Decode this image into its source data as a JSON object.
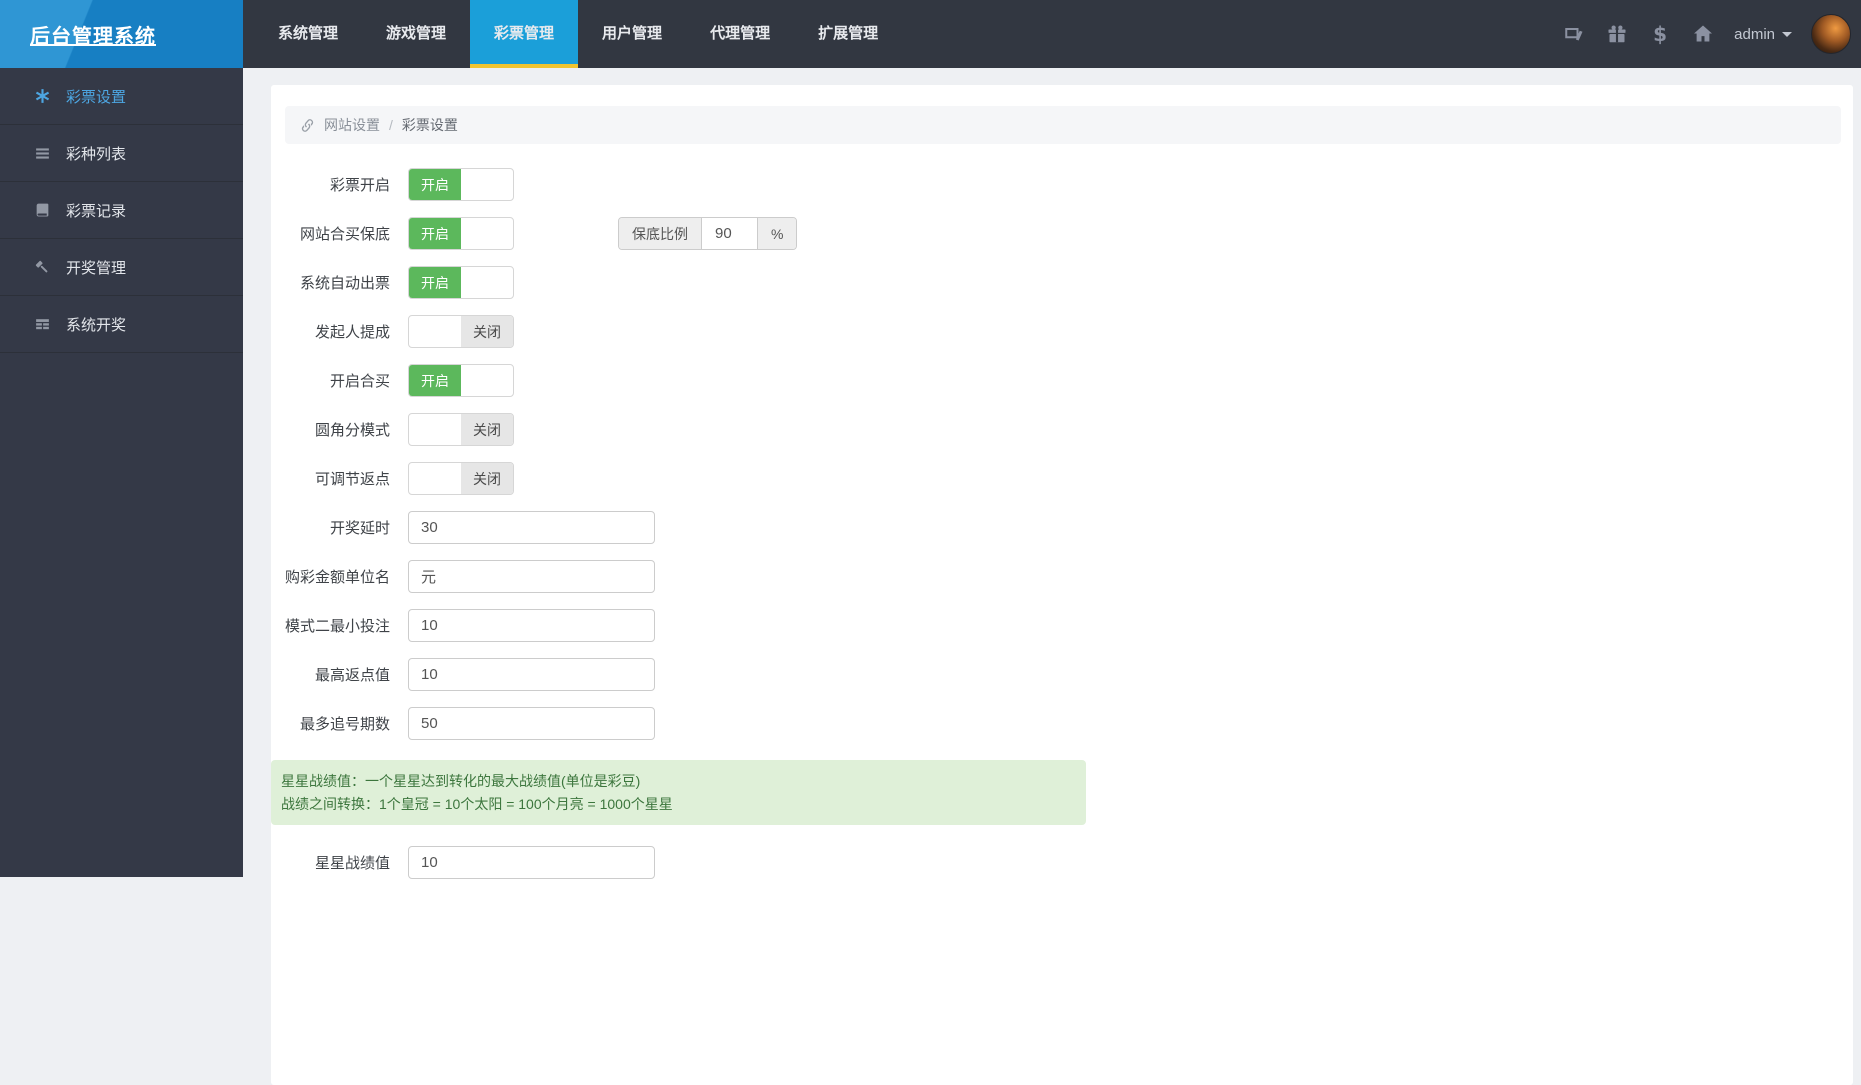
{
  "app": {
    "title": "后台管理系统"
  },
  "topnav": {
    "items": [
      {
        "label": "系统管理",
        "active": false
      },
      {
        "label": "游戏管理",
        "active": false
      },
      {
        "label": "彩票管理",
        "active": true
      },
      {
        "label": "用户管理",
        "active": false
      },
      {
        "label": "代理管理",
        "active": false
      },
      {
        "label": "扩展管理",
        "active": false
      }
    ],
    "icons": [
      "monitor-icon",
      "gift-icon",
      "dollar-icon",
      "home-icon"
    ],
    "user": "admin"
  },
  "sidebar": {
    "items": [
      {
        "label": "彩票设置",
        "icon": "asterisk-icon",
        "active": true
      },
      {
        "label": "彩种列表",
        "icon": "list-icon",
        "active": false
      },
      {
        "label": "彩票记录",
        "icon": "book-icon",
        "active": false
      },
      {
        "label": "开奖管理",
        "icon": "gavel-icon",
        "active": false
      },
      {
        "label": "系统开奖",
        "icon": "table-icon",
        "active": false
      }
    ]
  },
  "breadcrumb": {
    "parent": "网站设置",
    "separator": "/",
    "current": "彩票设置"
  },
  "form": {
    "toggle_on_label": "开启",
    "toggle_off_label": "关闭",
    "rows": [
      {
        "label": "彩票开启",
        "type": "toggle",
        "on": true
      },
      {
        "label": "网站合买保底",
        "type": "toggle",
        "on": true,
        "guarantee": true
      },
      {
        "label": "系统自动出票",
        "type": "toggle",
        "on": true
      },
      {
        "label": "发起人提成",
        "type": "toggle",
        "on": false
      },
      {
        "label": "开启合买",
        "type": "toggle",
        "on": true
      },
      {
        "label": "圆角分模式",
        "type": "toggle",
        "on": false
      },
      {
        "label": "可调节返点",
        "type": "toggle",
        "on": false
      },
      {
        "label": "开奖延时",
        "type": "input",
        "value": "30"
      },
      {
        "label": "购彩金额单位名",
        "type": "input",
        "value": "元"
      },
      {
        "label": "模式二最小投注",
        "type": "input",
        "value": "10"
      },
      {
        "label": "最高返点值",
        "type": "input",
        "value": "10"
      },
      {
        "label": "最多追号期数",
        "type": "input",
        "value": "50"
      }
    ],
    "guarantee": {
      "label": "保底比例",
      "value": "90",
      "unit": "%"
    },
    "alert": {
      "line1": "星星战绩值：一个星星达到转化的最大战绩值(单位是彩豆)",
      "line2": "战绩之间转换：1个皇冠 = 10个太阳 = 100个月亮 = 1000个星星"
    },
    "last_row": {
      "label": "星星战绩值",
      "type": "input",
      "value": "10"
    }
  },
  "colors": {
    "accent_blue": "#1b9fd9",
    "tab_underline_yellow": "#f0c42f",
    "toggle_on_green": "#5cb85c",
    "alert_bg": "#dff0d8",
    "alert_text": "#3c763d",
    "header_bg": "#323741",
    "sidebar_bg": "#343947",
    "logo_blue": "#177fc3"
  }
}
